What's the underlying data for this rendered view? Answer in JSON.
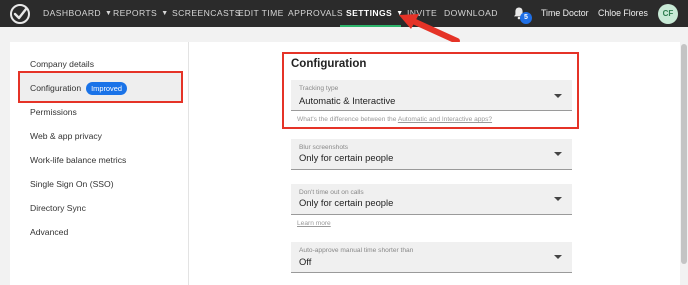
{
  "nav": {
    "items": [
      "DASHBOARD",
      "REPORTS",
      "SCREENCASTS",
      "EDIT TIME",
      "APPROVALS",
      "SETTINGS",
      "INVITE",
      "DOWNLOAD"
    ],
    "active": "SETTINGS",
    "notification_count": "5",
    "company": "Time Doctor",
    "user_name": "Chloe Flores",
    "user_initials": "CF"
  },
  "sidebar": {
    "items": [
      {
        "label": "Company details"
      },
      {
        "label": "Configuration",
        "badge": "Improved",
        "active": true
      },
      {
        "label": "Permissions"
      },
      {
        "label": "Web & app privacy"
      },
      {
        "label": "Work-life balance metrics"
      },
      {
        "label": "Single Sign On (SSO)"
      },
      {
        "label": "Directory Sync"
      },
      {
        "label": "Advanced"
      }
    ]
  },
  "main": {
    "title": "Configuration",
    "fields": [
      {
        "label": "Tracking type",
        "value": "Automatic & Interactive",
        "helper_prefix": "What's the difference between the ",
        "helper_link": "Automatic and Interactive apps?"
      },
      {
        "label": "Blur screenshots",
        "value": "Only for certain people"
      },
      {
        "label": "Don't time out on calls",
        "value": "Only for certain people",
        "helper_link": "Learn more"
      },
      {
        "label": "Auto-approve manual time shorter than",
        "value": "Off"
      }
    ]
  },
  "colors": {
    "nav_bg": "#2b2b2b",
    "active_underline": "#2db46b",
    "badge": "#1a73e8",
    "highlight_box": "#e53327"
  },
  "icons": [
    "time-doctor-logo-icon",
    "chevron-down-icon",
    "bell-icon",
    "dropdown-caret-icon",
    "red-arrow-icon"
  ]
}
